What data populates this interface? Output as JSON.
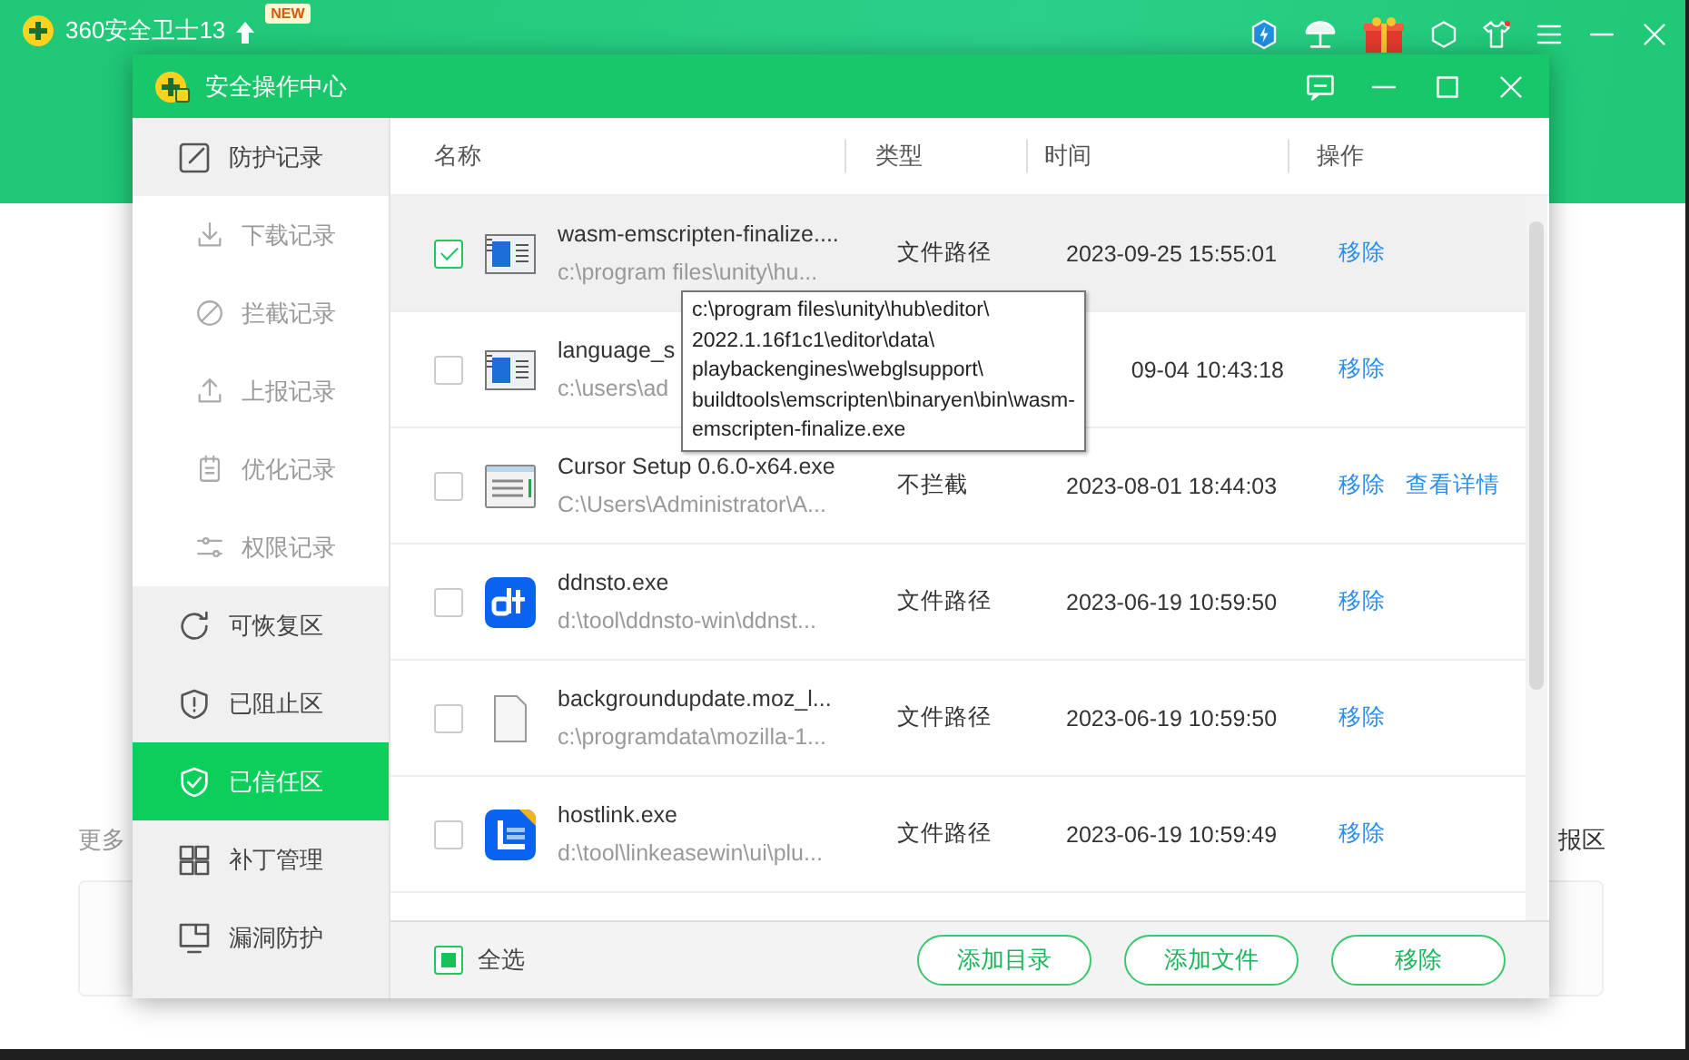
{
  "app": {
    "title": "360安全卫士13",
    "badge": "NEW",
    "left_text": "更多",
    "right_text": "报区"
  },
  "dialog": {
    "title": "安全操作中心"
  },
  "sidebar": {
    "items": [
      {
        "kind": "group",
        "label": "防护记录",
        "selected": false
      },
      {
        "kind": "sub",
        "label": "下载记录",
        "selected": false
      },
      {
        "kind": "sub",
        "label": "拦截记录",
        "selected": false
      },
      {
        "kind": "sub",
        "label": "上报记录",
        "selected": false
      },
      {
        "kind": "sub",
        "label": "优化记录",
        "selected": false
      },
      {
        "kind": "sub",
        "label": "权限记录",
        "selected": false
      },
      {
        "kind": "group",
        "label": "可恢复区",
        "selected": false
      },
      {
        "kind": "group",
        "label": "已阻止区",
        "selected": false
      },
      {
        "kind": "group",
        "label": "已信任区",
        "selected": true
      },
      {
        "kind": "group",
        "label": "补丁管理",
        "selected": false
      },
      {
        "kind": "group",
        "label": "漏洞防护",
        "selected": false
      }
    ]
  },
  "table": {
    "columns": [
      "名称",
      "类型",
      "时间",
      "操作"
    ],
    "rows": [
      {
        "checked": true,
        "name": "wasm-emscripten-finalize....",
        "path": "c:\\program files\\unity\\hu...",
        "type": "文件路径",
        "time": "2023-09-25 15:55:01",
        "actions": [
          "移除"
        ]
      },
      {
        "checked": false,
        "name": "language_s",
        "path": "c:\\users\\ad",
        "time": "09-04 10:43:18",
        "actions": [
          "移除"
        ]
      },
      {
        "checked": false,
        "name": "Cursor Setup 0.6.0-x64.exe",
        "path": "C:\\Users\\Administrator\\A...",
        "type": "不拦截",
        "time": "2023-08-01 18:44:03",
        "actions": [
          "移除",
          "查看详情"
        ]
      },
      {
        "checked": false,
        "name": "ddnsto.exe",
        "path": "d:\\tool\\ddnsto-win\\ddnst...",
        "type": "文件路径",
        "time": "2023-06-19 10:59:50",
        "actions": [
          "移除"
        ]
      },
      {
        "checked": false,
        "name": "backgroundupdate.moz_l...",
        "path": "c:\\programdata\\mozilla-1...",
        "type": "文件路径",
        "time": "2023-06-19 10:59:50",
        "actions": [
          "移除"
        ]
      },
      {
        "checked": false,
        "name": "hostlink.exe",
        "path": "d:\\tool\\linkeasewin\\ui\\plu...",
        "type": "文件路径",
        "time": "2023-06-19 10:59:49",
        "actions": [
          "移除"
        ]
      }
    ]
  },
  "tooltip": {
    "lines": [
      "c:\\program files\\unity\\hub\\editor\\",
      "2022.1.16f1c1\\editor\\data\\",
      "playbackengines\\webglsupport\\",
      "buildtools\\emscripten\\binaryen\\bin\\wasm-",
      "emscripten-finalize.exe"
    ]
  },
  "footer": {
    "select_all": {
      "label": "全选",
      "checked": false,
      "indeterminate": true
    },
    "buttons": [
      "添加目录",
      "添加文件",
      "移除"
    ]
  }
}
